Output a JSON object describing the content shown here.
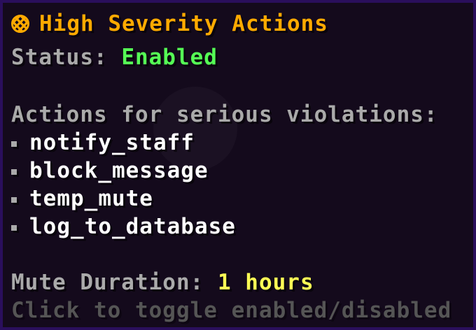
{
  "tooltip": {
    "title": "High Severity Actions",
    "title_icon": "target-icon",
    "status_label": "Status: ",
    "status_value": "Enabled",
    "actions_header": "Actions for serious violations:",
    "actions": [
      "notify_staff",
      "block_message",
      "temp_mute",
      "log_to_database"
    ],
    "duration_label": "Mute Duration: ",
    "duration_value": "1 hours",
    "hint": "Click to toggle enabled/disabled"
  },
  "colors": {
    "title": "#ffaa00",
    "enabled": "#55ff55",
    "duration": "#ffff55",
    "label": "#aaaaaa",
    "item": "#ffffff",
    "hint": "#555555",
    "border": "#2a0f5c",
    "background": "#140a1c"
  }
}
